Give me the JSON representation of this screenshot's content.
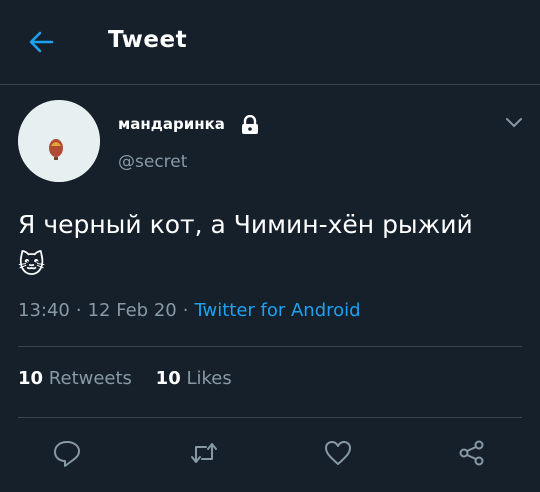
{
  "header": {
    "title": "Tweet",
    "back_icon": "arrow-left-icon"
  },
  "user": {
    "name": "мандаринка",
    "handle": "@secret",
    "protected_icon": "lock-icon",
    "avatar_icon": "hot-air-balloon-icon"
  },
  "tweet": {
    "text": "Я черный кот, а Чимин-хён рыжий",
    "emoji": "🐱",
    "time": "13:40",
    "date": "12 Feb 20",
    "source": "Twitter for Android"
  },
  "stats": {
    "retweets_count": "10",
    "retweets_label": "Retweets",
    "likes_count": "10",
    "likes_label": "Likes"
  },
  "actions": [
    "reply-icon",
    "retweet-icon",
    "like-icon",
    "share-icon"
  ],
  "colors": {
    "background": "#15202b",
    "accent": "#1da1f2",
    "muted": "#8899a6",
    "divider": "#38444d"
  }
}
